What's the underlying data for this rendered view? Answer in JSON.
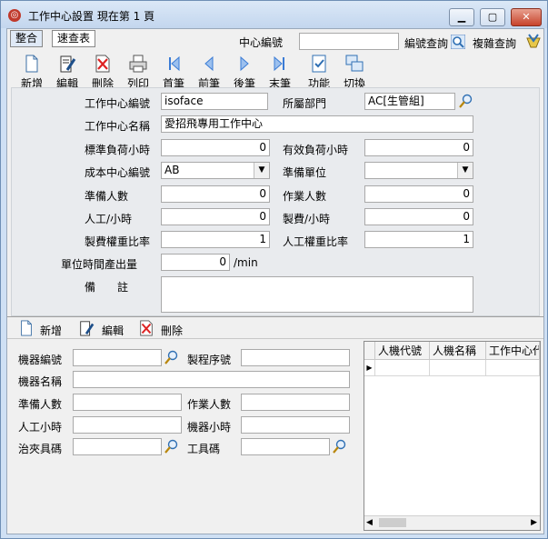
{
  "window": {
    "title": "工作中心設置  現在第 1 頁",
    "minimize": "▁",
    "maximize": "▢",
    "close": "✕"
  },
  "tabs": [
    "整合",
    "速查表"
  ],
  "search": {
    "label": "中心編號",
    "value": "",
    "code_query": "編號查詢",
    "complex_query": "複雜查詢"
  },
  "toolbar": [
    "新增",
    "編輯",
    "刪除",
    "列印",
    "首筆",
    "前筆",
    "後筆",
    "末筆",
    "功能",
    "切換"
  ],
  "form": {
    "wc_code_label": "工作中心編號",
    "wc_code_value": "isoface",
    "dept_label": "所屬部門",
    "dept_value": "AC[生管組]",
    "wc_name_label": "工作中心名稱",
    "wc_name_value": "愛招飛專用工作中心",
    "std_load_label": "標準負荷小時",
    "std_load_value": "0",
    "eff_load_label": "有效負荷小時",
    "eff_load_value": "0",
    "cost_center_label": "成本中心編號",
    "cost_center_value": "AB",
    "prep_unit_label": "準備單位",
    "prep_unit_value": "",
    "prep_people_label": "準備人數",
    "prep_people_value": "0",
    "work_people_label": "作業人數",
    "work_people_value": "0",
    "labor_hour_label": "人工/小時",
    "labor_hour_value": "0",
    "mfg_hour_label": "製費/小時",
    "mfg_hour_value": "0",
    "mfg_weight_label": "製費權重比率",
    "mfg_weight_value": "1",
    "labor_weight_label": "人工權重比率",
    "labor_weight_value": "1",
    "unit_output_label": "單位時間產出量",
    "unit_output_value": "0",
    "unit_output_unit": "/min",
    "remark_label": "備　　註",
    "remark_value": ""
  },
  "detail_toolbar": [
    "新增",
    "編輯",
    "刪除"
  ],
  "detail": {
    "machine_code_label": "機器編號",
    "machine_code_value": "",
    "process_no_label": "製程序號",
    "process_no_value": "",
    "machine_name_label": "機器名稱",
    "machine_name_value": "",
    "prep_people_label": "準備人數",
    "prep_people_value": "",
    "work_people_label": "作業人數",
    "work_people_value": "",
    "labor_hours_label": "人工小時",
    "labor_hours_value": "",
    "machine_hours_label": "機器小時",
    "machine_hours_value": "",
    "fixture_label": "治夾具碼",
    "fixture_value": "",
    "tool_label": "工具碼",
    "tool_value": ""
  },
  "grid": {
    "columns": [
      "人機代號",
      "人機名稱",
      "工作中心代"
    ],
    "row_indicator": "▶"
  },
  "colors": {
    "window_frame": "#cfe0f4",
    "close_button": "#c7432b",
    "accent_blue": "#2f6fb3"
  }
}
